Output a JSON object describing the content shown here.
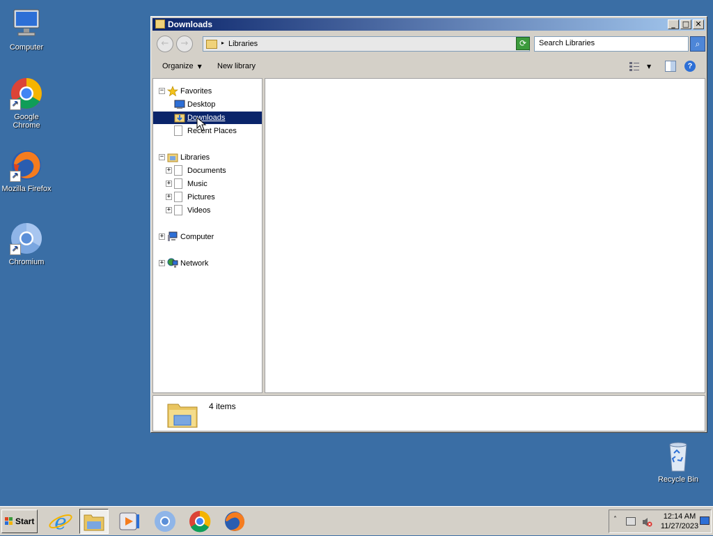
{
  "desktop": {
    "icons": [
      {
        "label": "Computer"
      },
      {
        "label": "Google Chrome"
      },
      {
        "label": "Mozilla Firefox"
      },
      {
        "label": "Chromium"
      },
      {
        "label": "Recycle Bin"
      }
    ]
  },
  "window": {
    "title": "Downloads",
    "address": {
      "crumb": "Libraries"
    },
    "search": {
      "placeholder": "Search Libraries"
    },
    "commands": {
      "organize": "Organize",
      "new_library": "New library"
    },
    "tree": {
      "favorites": "Favorites",
      "desktop": "Desktop",
      "downloads": "Downloads",
      "recent_places": "Recent Places",
      "libraries": "Libraries",
      "documents": "Documents",
      "music": "Music",
      "pictures": "Pictures",
      "videos": "Videos",
      "computer": "Computer",
      "network": "Network"
    },
    "status": {
      "count": "4 items"
    }
  },
  "taskbar": {
    "start": "Start",
    "clock": {
      "time": "12:14 AM",
      "date": "11/27/2023"
    }
  },
  "colors": {
    "desktop": "#3a6ea5",
    "selection": "#0a246a",
    "title_start": "#0a246a",
    "title_end": "#a6caf0"
  }
}
